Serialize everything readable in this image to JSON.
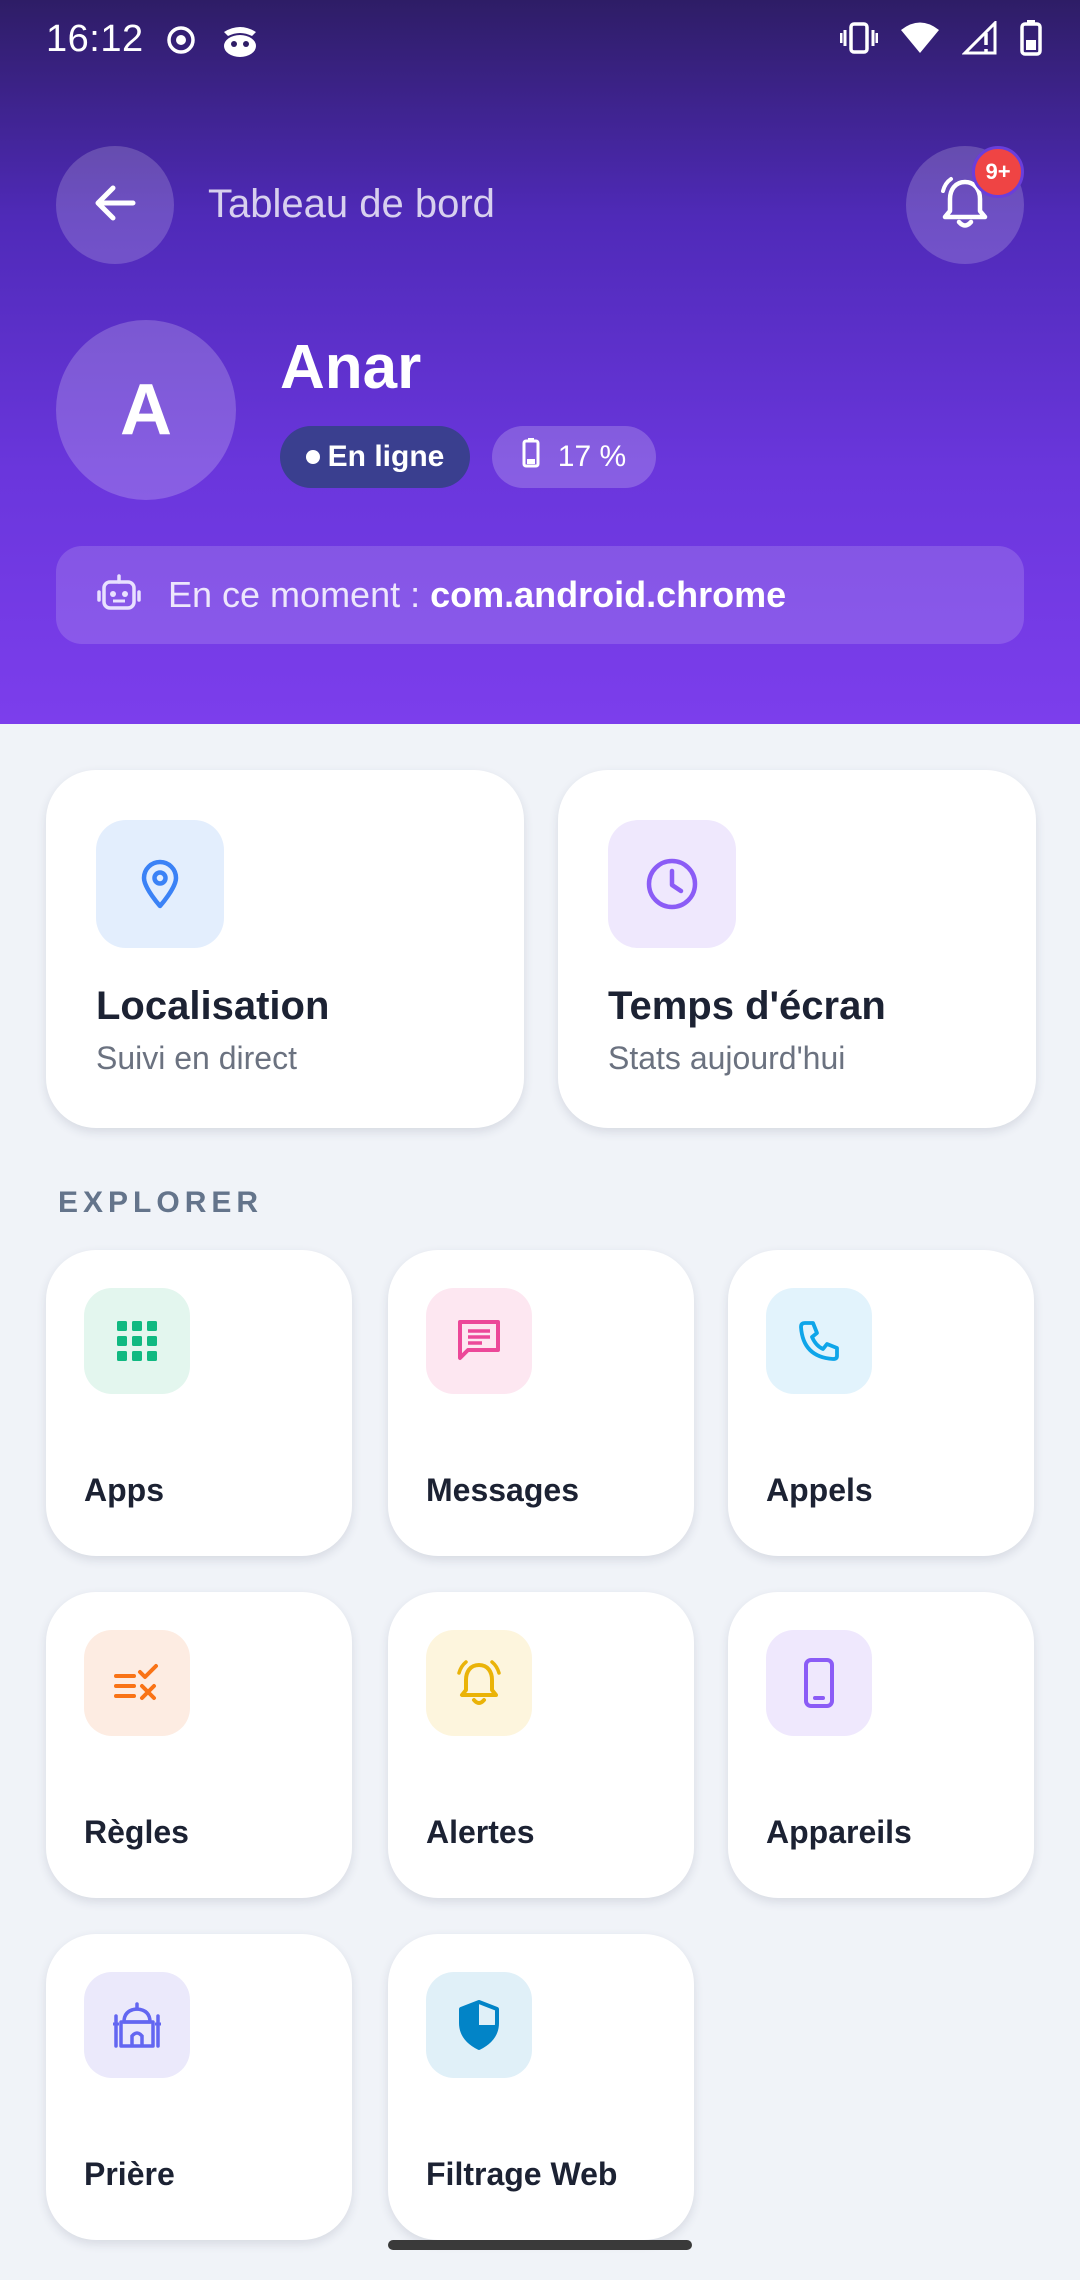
{
  "status_bar": {
    "time": "16:12",
    "icons": [
      "radio-icon",
      "app-mascot-icon",
      "vibrate-icon",
      "wifi-icon",
      "signal-icon",
      "battery-icon"
    ]
  },
  "header": {
    "title": "Tableau de bord",
    "notification_badge": "9+"
  },
  "profile": {
    "avatar_letter": "A",
    "name": "Anar",
    "status": "En ligne",
    "battery": "17 %"
  },
  "current_activity": {
    "label": "En ce moment : ",
    "app": "com.android.chrome"
  },
  "features": [
    {
      "title": "Localisation",
      "subtitle": "Suivi en direct",
      "icon": "location-pin-icon",
      "icon_bg": "#e3eefd",
      "icon_color": "#3b82f6"
    },
    {
      "title": "Temps d'écran",
      "subtitle": "Stats aujourd'hui",
      "icon": "clock-icon",
      "icon_bg": "#efe8fd",
      "icon_color": "#8b5cf6"
    }
  ],
  "explorer": {
    "title": "EXPLORER",
    "tiles": [
      {
        "label": "Apps",
        "icon": "grid-icon",
        "icon_bg": "#e3f6ee",
        "icon_color": "#10b981"
      },
      {
        "label": "Messages",
        "icon": "message-icon",
        "icon_bg": "#fde7f1",
        "icon_color": "#ec4899"
      },
      {
        "label": "Appels",
        "icon": "phone-icon",
        "icon_bg": "#e2f3fc",
        "icon_color": "#0ea5e9"
      },
      {
        "label": "Règles",
        "icon": "rules-icon",
        "icon_bg": "#fdece2",
        "icon_color": "#f97316"
      },
      {
        "label": "Alertes",
        "icon": "alarm-icon",
        "icon_bg": "#fdf5dd",
        "icon_color": "#eab308"
      },
      {
        "label": "Appareils",
        "icon": "smartphone-icon",
        "icon_bg": "#efe8fd",
        "icon_color": "#8b5cf6"
      },
      {
        "label": "Prière",
        "icon": "mosque-icon",
        "icon_bg": "#ebe9fb",
        "icon_color": "#6366f1"
      },
      {
        "label": "Filtrage Web",
        "icon": "shield-icon",
        "icon_bg": "#e0f0f8",
        "icon_color": "#0284c7"
      }
    ]
  }
}
